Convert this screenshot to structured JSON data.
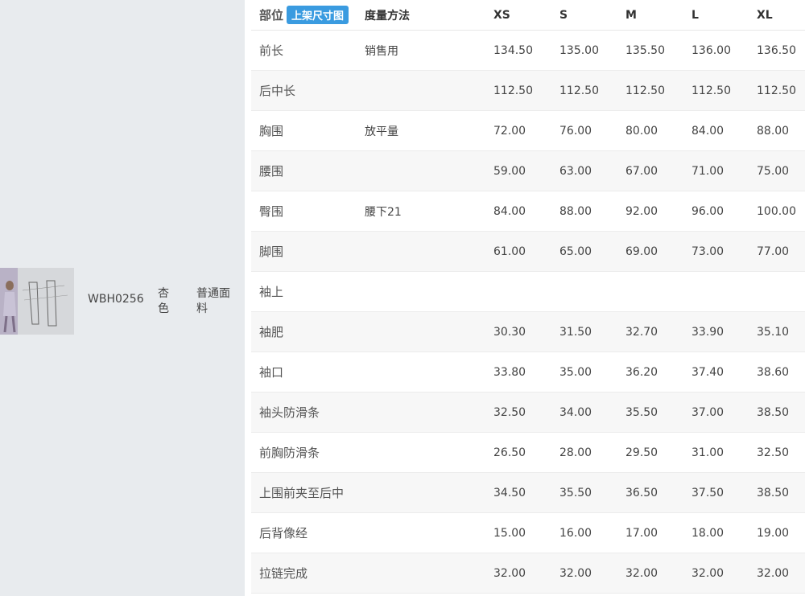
{
  "product": {
    "code": "WBH0256",
    "color": "杏色",
    "fabric": "普通面料"
  },
  "table": {
    "headers": {
      "part": "部位",
      "badge": "上架尺寸图",
      "method": "度量方法",
      "xs": "XS",
      "s": "S",
      "m": "M",
      "l": "L",
      "xl": "XL"
    },
    "rows": [
      {
        "part": "前长",
        "method": "销售用",
        "xs": "134.50",
        "s": "135.00",
        "m": "135.50",
        "l": "136.00",
        "xl": "136.50"
      },
      {
        "part": "后中长",
        "method": "",
        "xs": "112.50",
        "s": "112.50",
        "m": "112.50",
        "l": "112.50",
        "xl": "112.50"
      },
      {
        "part": "胸围",
        "method": "放平量",
        "xs": "72.00",
        "s": "76.00",
        "m": "80.00",
        "l": "84.00",
        "xl": "88.00"
      },
      {
        "part": "腰围",
        "method": "",
        "xs": "59.00",
        "s": "63.00",
        "m": "67.00",
        "l": "71.00",
        "xl": "75.00"
      },
      {
        "part": "臀围",
        "method": "腰下21",
        "xs": "84.00",
        "s": "88.00",
        "m": "92.00",
        "l": "96.00",
        "xl": "100.00"
      },
      {
        "part": "脚围",
        "method": "",
        "xs": "61.00",
        "s": "65.00",
        "m": "69.00",
        "l": "73.00",
        "xl": "77.00"
      },
      {
        "part": "袖上",
        "method": "",
        "xs": "",
        "s": "",
        "m": "",
        "l": "",
        "xl": ""
      },
      {
        "part": "袖肥",
        "method": "",
        "xs": "30.30",
        "s": "31.50",
        "m": "32.70",
        "l": "33.90",
        "xl": "35.10"
      },
      {
        "part": "袖口",
        "method": "",
        "xs": "33.80",
        "s": "35.00",
        "m": "36.20",
        "l": "37.40",
        "xl": "38.60"
      },
      {
        "part": "袖头防滑条",
        "method": "",
        "xs": "32.50",
        "s": "34.00",
        "m": "35.50",
        "l": "37.00",
        "xl": "38.50"
      },
      {
        "part": "前胸防滑条",
        "method": "",
        "xs": "26.50",
        "s": "28.00",
        "m": "29.50",
        "l": "31.00",
        "xl": "32.50"
      },
      {
        "part": "上围前夹至后中",
        "method": "",
        "xs": "34.50",
        "s": "35.50",
        "m": "36.50",
        "l": "37.50",
        "xl": "38.50"
      },
      {
        "part": "后背像经",
        "method": "",
        "xs": "15.00",
        "s": "16.00",
        "m": "17.00",
        "l": "18.00",
        "xl": "19.00"
      },
      {
        "part": "拉链完成",
        "method": "",
        "xs": "32.00",
        "s": "32.00",
        "m": "32.00",
        "l": "32.00",
        "xl": "32.00"
      }
    ]
  }
}
